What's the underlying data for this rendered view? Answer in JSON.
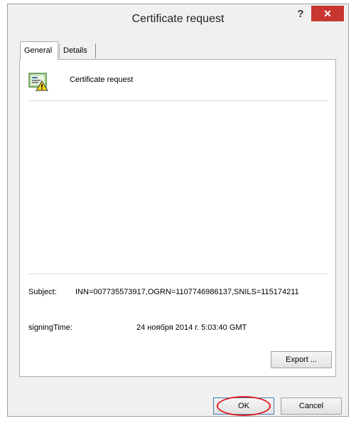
{
  "window": {
    "title": "Certificate request",
    "help_label": "?",
    "close_label": "✕"
  },
  "tabs": [
    {
      "label": "General"
    },
    {
      "label": "Details"
    }
  ],
  "certificate": {
    "heading": "Certificate request",
    "icon": "certificate-warning-icon"
  },
  "fields": {
    "subject_label": "Subject:",
    "subject_value": "INN=007735573917,OGRN=1107746986137,SNILS=115174211",
    "signing_time_label": "signingTime:",
    "signing_time_value": "24 ноября 2014 г. 5:03:40 GMT"
  },
  "buttons": {
    "export": "Export ...",
    "ok": "OK",
    "cancel": "Cancel"
  },
  "colors": {
    "close_button": "#c7362f",
    "highlight": "#e11b22"
  }
}
